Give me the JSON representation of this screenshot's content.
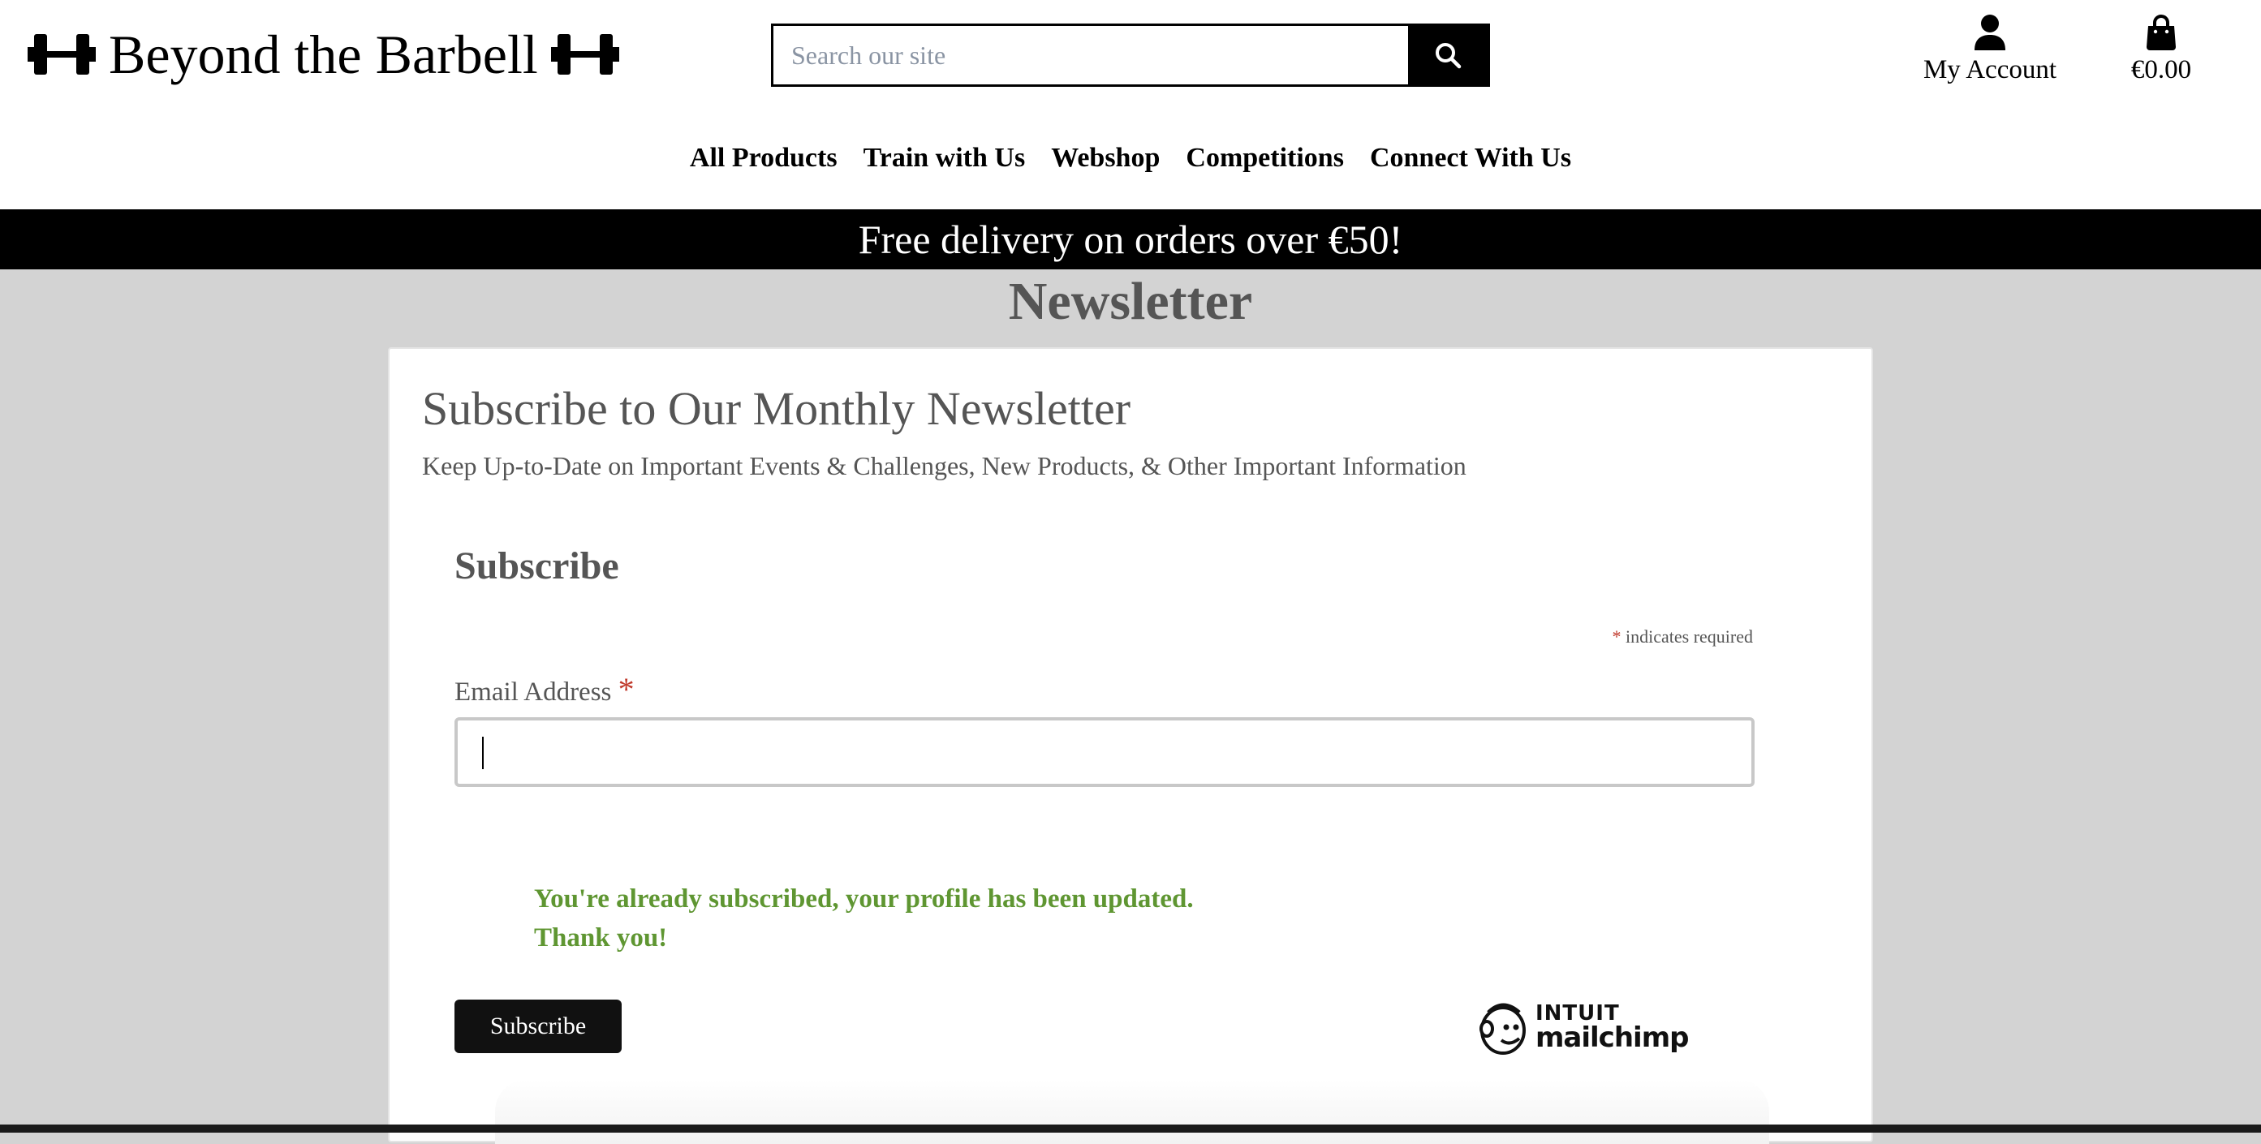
{
  "header": {
    "logo_text": "Beyond the Barbell",
    "search": {
      "placeholder": "Search our site"
    },
    "account_label": "My Account",
    "cart_total": "€0.00"
  },
  "nav": {
    "items": [
      "All Products",
      "Train with Us",
      "Webshop",
      "Competitions",
      "Connect With Us"
    ]
  },
  "banner": {
    "text": "Free delivery on orders over €50!"
  },
  "page": {
    "title": "Newsletter"
  },
  "card": {
    "heading": "Subscribe to Our Monthly Newsletter",
    "subheading": "Keep Up-to-Date on Important Events & Challenges, New Products, & Other Important Information"
  },
  "form": {
    "title": "Subscribe",
    "required_asterisk": "*",
    "required_note": "indicates required",
    "email_label": "Email Address",
    "email_value": "",
    "success_line1": "You're already subscribed, your profile has been updated.",
    "success_line2": "Thank you!",
    "submit_label": "Subscribe"
  },
  "mailchimp": {
    "line1": "INTUIT",
    "line2": "mailchimp"
  },
  "colors": {
    "page_bg": "#d3d3d3",
    "banner_bg": "#000000",
    "success_text": "#5f9632",
    "required_asterisk": "#c0392b"
  }
}
